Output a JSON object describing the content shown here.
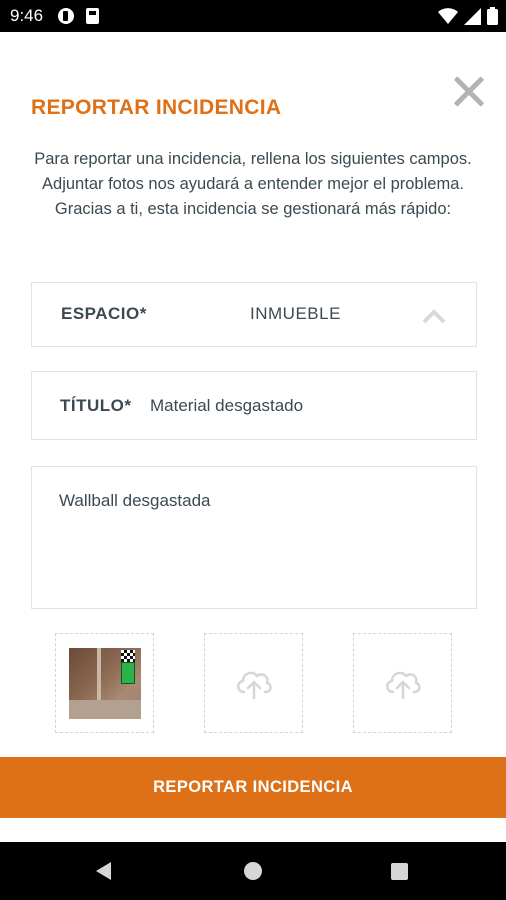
{
  "status_bar": {
    "time": "9:46",
    "icons": [
      "app-notification-icon",
      "sim-card-icon",
      "wifi-icon",
      "cellular-signal-icon",
      "battery-icon"
    ]
  },
  "dialog": {
    "title": "REPORTAR INCIDENCIA",
    "description": "Para reportar una incidencia, rellena los siguientes campos. Adjuntar fotos nos ayudará a entender mejor el problema. Gracias a ti, esta incidencia se gestionará más rápido:",
    "space_field": {
      "label": "ESPACIO*",
      "value": "INMUEBLE"
    },
    "title_field": {
      "label": "TÍTULO*",
      "value": "Material desgastado"
    },
    "description_field": {
      "value": "Wallball desgastada"
    },
    "photos": [
      {
        "state": "filled",
        "icon": "photo-thumbnail"
      },
      {
        "state": "empty",
        "icon": "cloud-upload-icon"
      },
      {
        "state": "empty",
        "icon": "cloud-upload-icon"
      }
    ],
    "submit_label": "REPORTAR INCIDENCIA"
  },
  "colors": {
    "accent": "#de7117",
    "text": "#3b4a52",
    "border": "#e3e3e3",
    "close_icon": "#b3b3b3"
  },
  "nav_bar": {
    "icons": [
      "back-icon",
      "home-icon",
      "recent-apps-icon"
    ]
  }
}
